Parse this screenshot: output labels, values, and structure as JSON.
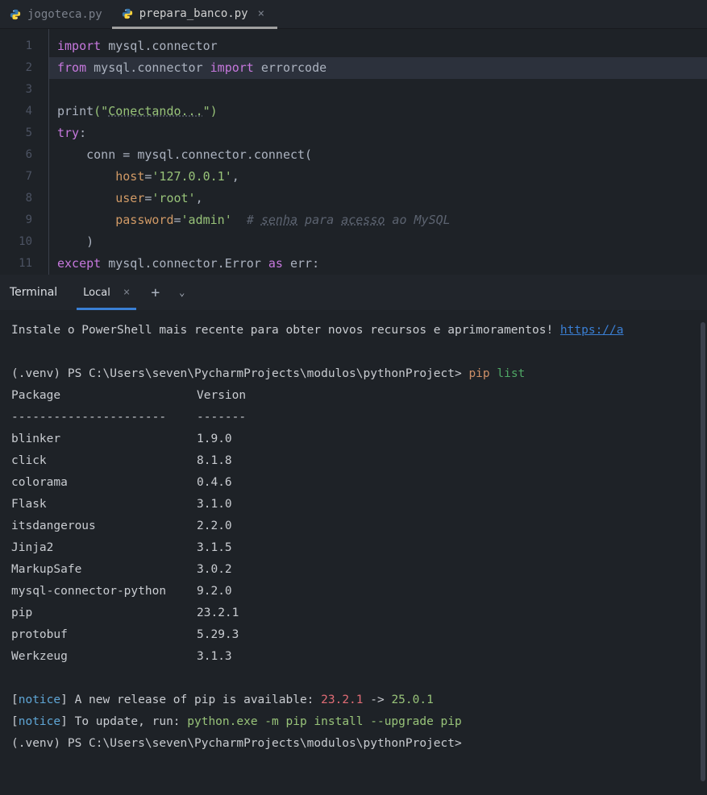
{
  "tabs": [
    {
      "label": "jogoteca.py",
      "active": false
    },
    {
      "label": "prepara_banco.py",
      "active": true
    }
  ],
  "line_numbers": [
    "1",
    "2",
    "3",
    "4",
    "5",
    "6",
    "7",
    "8",
    "9",
    "10",
    "11"
  ],
  "code": {
    "l1_import": "import",
    "l1_mod": "mysql.connector",
    "l2_from": "from",
    "l2_mod": "mysql.connector",
    "l2_import": "import",
    "l2_err": "errorcode",
    "l4_print": "print",
    "l4_par_open": "(\"",
    "l4_str": "Conectando...",
    "l4_par_close": "\")",
    "l5_try": "try",
    "l5_colon": ":",
    "l6_conn": "conn = mysql.connector.connect(",
    "l7_host": "host",
    "l7_eq": "=",
    "l7_val": "'127.0.0.1'",
    "l7_comma": ",",
    "l8_user": "user",
    "l8_val": "'root'",
    "l8_comma": ",",
    "l9_pass": "password",
    "l9_val": "'admin'",
    "l9_hash": "# ",
    "l9_senha": "senha",
    "l9_para": " para ",
    "l9_acesso": "acesso",
    "l9_ao": " ao MySQL",
    "l10_close": ")",
    "l11_except": "except",
    "l11_mod": "mysql.connector.Error",
    "l11_as": "as",
    "l11_err": "err:"
  },
  "terminal": {
    "title": "Terminal",
    "tab_label": "Local",
    "banner_pre": "Instale o PowerShell mais recente para obter novos recursos e aprimoramentos! ",
    "banner_link": "https://a",
    "prompt1_pre": "(.venv) PS C:\\Users\\seven\\PycharmProjects\\modulos\\pythonProject> ",
    "prompt1_cmd1": "pip",
    "prompt1_cmd2": " list",
    "header_pkg": "Package",
    "header_ver": "Version",
    "divider_pkg": "----------------------",
    "divider_ver": "-------",
    "packages": [
      {
        "name": "blinker",
        "version": "1.9.0"
      },
      {
        "name": "click",
        "version": "8.1.8"
      },
      {
        "name": "colorama",
        "version": "0.4.6"
      },
      {
        "name": "Flask",
        "version": "3.1.0"
      },
      {
        "name": "itsdangerous",
        "version": "2.2.0"
      },
      {
        "name": "Jinja2",
        "version": "3.1.5"
      },
      {
        "name": "MarkupSafe",
        "version": "3.0.2"
      },
      {
        "name": "mysql-connector-python",
        "version": "9.2.0"
      },
      {
        "name": "pip",
        "version": "23.2.1"
      },
      {
        "name": "protobuf",
        "version": "5.29.3"
      },
      {
        "name": "Werkzeug",
        "version": "3.1.3"
      }
    ],
    "notice1_open": "[",
    "notice1_tag": "notice",
    "notice1_close": "]",
    "notice1_text": " A new release of pip is available: ",
    "notice1_old": "23.2.1",
    "notice1_arrow": " -> ",
    "notice1_new": "25.0.1",
    "notice2_text": " To update, run: ",
    "notice2_cmd": "python.exe -m pip install --upgrade pip",
    "prompt2": "(.venv) PS C:\\Users\\seven\\PycharmProjects\\modulos\\pythonProject>"
  }
}
